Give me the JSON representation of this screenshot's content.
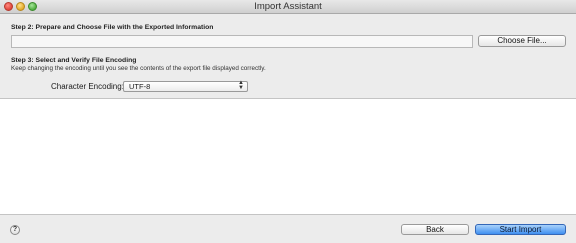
{
  "window": {
    "title": "Import Assistant"
  },
  "step2": {
    "label": "Step 2: Prepare and Choose File with the Exported Information",
    "path_value": "",
    "choose_button": "Choose File..."
  },
  "step3": {
    "label": "Step 3: Select and Verify File Encoding",
    "hint": "Keep changing the encoding until you see the contents of the export file displayed correctly.",
    "encoding_label": "Character Encoding:",
    "encoding_value": "UTF-8"
  },
  "preview": {
    "content": ""
  },
  "footer": {
    "help": "?",
    "back_button": "Back",
    "start_button": "Start Import"
  }
}
